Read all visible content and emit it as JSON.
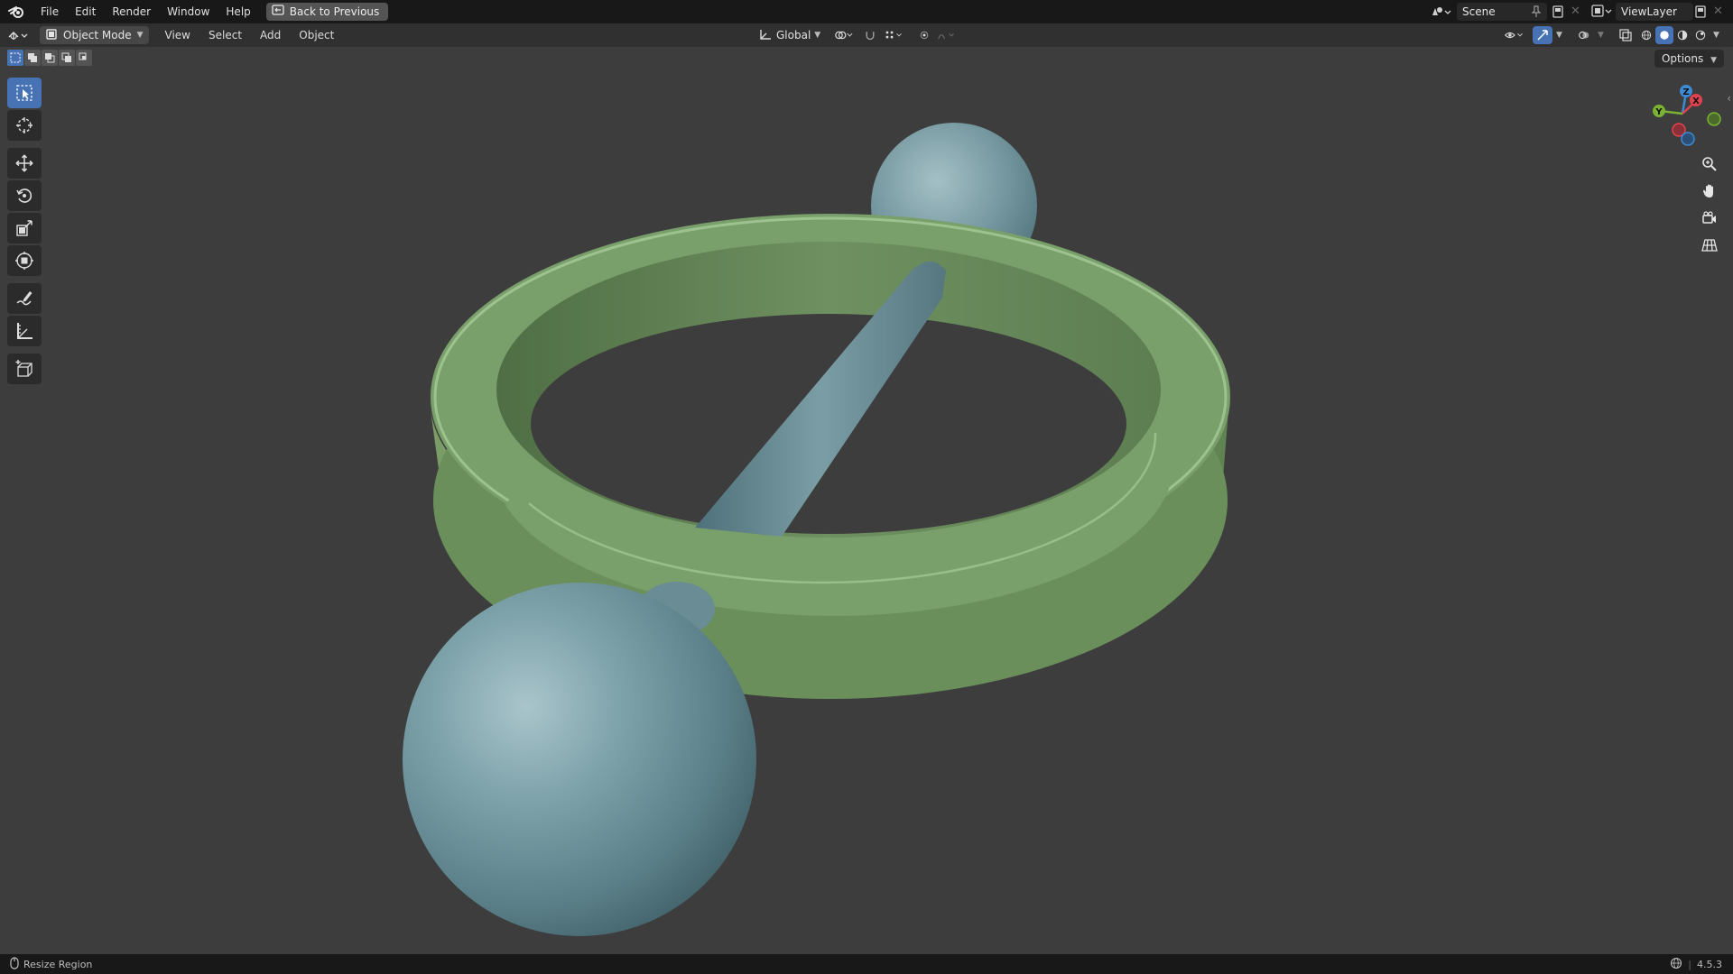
{
  "topbar": {
    "menus": [
      "File",
      "Edit",
      "Render",
      "Window",
      "Help"
    ],
    "back_label": "Back to Previous",
    "scene_label": "Scene",
    "viewlayer_label": "ViewLayer"
  },
  "header": {
    "mode_label": "Object Mode",
    "menus": [
      "View",
      "Select",
      "Add",
      "Object"
    ],
    "transform_orientation": "Global",
    "options_label": "Options"
  },
  "toolbar": {
    "tools": [
      "select-box",
      "cursor",
      "move",
      "rotate",
      "scale",
      "transform",
      "annotate",
      "measure",
      "add-cube"
    ],
    "active_tool": "select-box"
  },
  "gizmo": {
    "axes": [
      "Z",
      "X",
      "Y"
    ]
  },
  "viewport": {
    "objects": [
      "torus-ring",
      "sphere-top",
      "cylinder-rod",
      "sphere-front"
    ],
    "colors": {
      "ring": "#7a9e6a",
      "spheres": "#6f929b",
      "background": "#3d3d3d"
    }
  },
  "statusbar": {
    "left_label": "Resize Region",
    "version": "4.5.3"
  },
  "colors": {
    "accent": "#4772b3",
    "axis_x": "#e0434f",
    "axis_y": "#7ab233",
    "axis_z": "#3d8ad6"
  }
}
